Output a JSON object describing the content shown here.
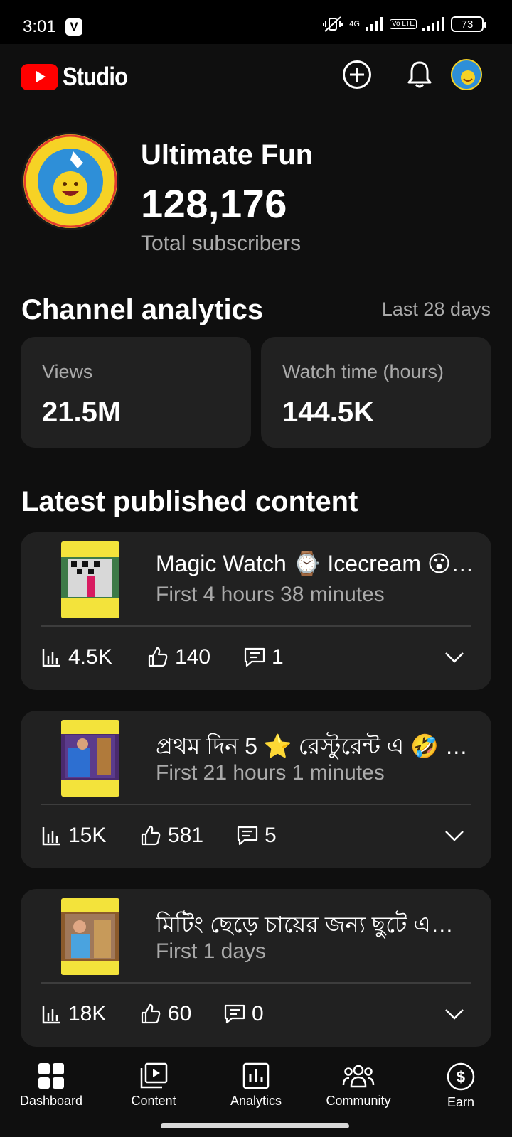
{
  "status_bar": {
    "time": "3:01",
    "network": "4G",
    "lte": "Vo LTE",
    "battery": "73"
  },
  "header": {
    "app_name": "Studio",
    "create_icon": "add-circle-icon",
    "notifications_icon": "bell-icon"
  },
  "channel": {
    "name": "Ultimate Fun",
    "subscribers": "128,176",
    "subscribers_label": "Total subscribers"
  },
  "analytics": {
    "title": "Channel analytics",
    "period": "Last 28 days",
    "metrics": [
      {
        "label": "Views",
        "value": "21.5M"
      },
      {
        "label": "Watch time (hours)",
        "value": "144.5K"
      }
    ]
  },
  "latest": {
    "title": "Latest published content",
    "items": [
      {
        "title": "Magic Watch ⌚ Icecream 😮…",
        "subtitle": "First 4 hours 38 minutes",
        "views": "4.5K",
        "likes": "140",
        "comments": "1"
      },
      {
        "title": "প্রথম দিন 5 ⭐ রেস্টুরেন্ট এ 🤣 …",
        "subtitle": "First 21 hours 1 minutes",
        "views": "15K",
        "likes": "581",
        "comments": "5"
      },
      {
        "title": "মিটিং ছেড়ে চায়ের জন্য ছুটে এ…",
        "subtitle": "First 1 days",
        "views": "18K",
        "likes": "60",
        "comments": "0"
      }
    ]
  },
  "nav": {
    "items": [
      {
        "label": "Dashboard",
        "icon": "dashboard-icon"
      },
      {
        "label": "Content",
        "icon": "content-icon"
      },
      {
        "label": "Analytics",
        "icon": "analytics-icon"
      },
      {
        "label": "Community",
        "icon": "community-icon"
      },
      {
        "label": "Earn",
        "icon": "earn-icon"
      }
    ]
  },
  "colors": {
    "background": "#0f0f0f",
    "card": "#212121",
    "brand_red": "#ff0000",
    "muted_text": "#aaaaaa"
  }
}
